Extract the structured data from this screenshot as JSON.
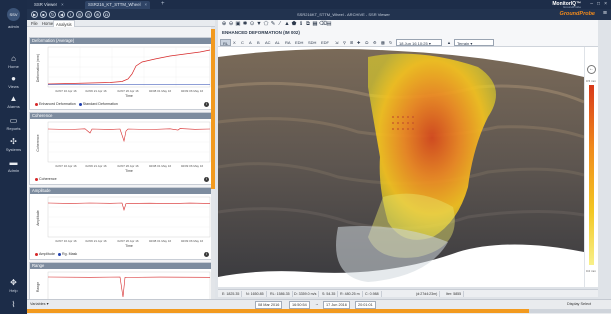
{
  "nav": {
    "user": "admin",
    "items": [
      {
        "label": "Home",
        "icon": "home-icon",
        "glyph": "⌂"
      },
      {
        "label": "Views",
        "icon": "pin-icon",
        "glyph": "●"
      },
      {
        "label": "Alarms",
        "icon": "alarm-icon",
        "glyph": "▲"
      },
      {
        "label": "Reports",
        "icon": "reports-icon",
        "glyph": "▭"
      },
      {
        "label": "Systems",
        "icon": "systems-icon",
        "glyph": "✣"
      },
      {
        "label": "Admin",
        "icon": "admin-icon",
        "glyph": "▬"
      }
    ],
    "bottom": [
      {
        "label": "Help",
        "icon": "help-icon",
        "glyph": "✥"
      },
      {
        "label": "",
        "icon": "chart-icon",
        "glyph": "⌇"
      }
    ]
  },
  "titlebar": {
    "tabs": [
      {
        "label": "SSR Viewer",
        "active": false
      },
      {
        "label": "SSR216_KT_STTM_Wheel",
        "active": true
      }
    ],
    "brand": "MonitorIQ™",
    "brand_sub": "GroundProbe"
  },
  "toolbar": {
    "caption": "SSR216KT_STTM_Wheel - ARCHIVE - SSR Viewer",
    "logo": "GroundProbe",
    "icons": [
      "play-icon",
      "stop-icon",
      "refresh-icon",
      "back-icon",
      "warning-icon",
      "target-icon",
      "clock-icon",
      "zoom-icon",
      "camera-icon"
    ]
  },
  "menu": {
    "items": [
      "File",
      "Home",
      "Analysis"
    ],
    "active": "Analysis"
  },
  "charts": [
    {
      "title": "Deformation (Average)",
      "legend": [
        {
          "label": "Enhanced Deformation",
          "color": "#d62728"
        },
        {
          "label": "Standard Deformation",
          "color": "#1f3fae"
        }
      ],
      "xlabel": "Time",
      "ylabel": "Deformation (mm)",
      "xticks": [
        "02/07 16 Apr 16",
        "02/06 21 Apr 16",
        "02/07 26 Apr 16",
        "02/08 01 May 16",
        "02/09 06 May 16"
      ]
    },
    {
      "title": "Coherence",
      "legend": [
        {
          "label": "Coherence",
          "color": "#d62728"
        }
      ],
      "xlabel": "Time",
      "ylabel": "Coherence",
      "xticks": [
        "02/07 16 Apr 16",
        "02/06 21 Apr 16",
        "02/07 26 Apr 16",
        "02/08 01 May 16",
        "02/09 06 May 16"
      ]
    },
    {
      "title": "Amplitude",
      "legend": [
        {
          "label": "Amplitude",
          "color": "#d62728"
        },
        {
          "label": "Rg. Mask",
          "color": "#1f3fae"
        }
      ],
      "xlabel": "Time",
      "ylabel": "Amplitude",
      "xticks": [
        "02/07 16 Apr 16",
        "02/06 21 Apr 16",
        "02/07 26 Apr 16",
        "02/08 01 May 16",
        "02/09 06 May 16"
      ]
    },
    {
      "title": "Range",
      "legend": [],
      "xlabel": "",
      "ylabel": "Range",
      "xticks": []
    }
  ],
  "viewer": {
    "title": "ENHANCED DEFORMATION (IM 002)",
    "modes": [
      "RL",
      "X",
      "C",
      "A",
      "B",
      "AC",
      "AL",
      "RA",
      "EDH",
      "SDH",
      "EDF"
    ],
    "date_value": "18 Jun 16 10:25",
    "terrain_value": "Terrain",
    "colorbar_top": "0.5 mm",
    "colorbar_bottom": "0.0 mm"
  },
  "status": {
    "fields": [
      "E: 1825.35",
      "N: 1650.85",
      "RL: 1586.35",
      "D: 3359.0 m/s",
      "S: 54.35",
      "R: 480.25 m",
      "C: 0.988",
      "(d:27d4:23m)",
      "Iter: 5855"
    ],
    "display": "Display Select"
  },
  "bottom": {
    "left": "Variables",
    "start_date": "08 Mar 2016",
    "start_time": "16:50:54",
    "end_date": "17 Jun 2016",
    "end_time": "20:01:01",
    "right": "Display Select",
    "progress": 0.86
  }
}
